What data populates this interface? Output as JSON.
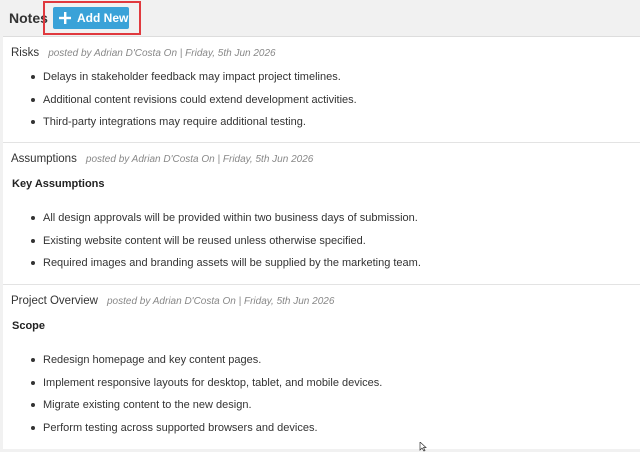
{
  "header": {
    "title": "Notes",
    "add_label": "Add New"
  },
  "notes": [
    {
      "title": "Risks",
      "meta": "posted by Adrian D'Costa On  | Friday, 5th Jun 2026",
      "subtitle": "",
      "items": [
        "Delays in stakeholder feedback may impact project timelines.",
        "Additional content revisions could extend development activities.",
        "Third-party integrations may require additional testing."
      ]
    },
    {
      "title": "Assumptions",
      "meta": "posted by Adrian D'Costa On  | Friday, 5th Jun 2026",
      "subtitle": "Key Assumptions",
      "items": [
        "All design approvals will be provided within two business days of submission.",
        "Existing website content will be reused unless otherwise specified.",
        "Required images and branding assets will be supplied by the marketing team."
      ]
    },
    {
      "title": "Project Overview",
      "meta": "posted by Adrian D'Costa On  | Friday, 5th Jun 2026",
      "subtitle": "Scope",
      "items": [
        "Redesign homepage and key content pages.",
        "Implement responsive layouts for desktop, tablet, and mobile devices.",
        "Migrate existing content to the new design.",
        "Perform testing across supported browsers and devices."
      ]
    }
  ],
  "colors": {
    "accent": "#3aa2d8",
    "highlight": "#e0393e"
  }
}
